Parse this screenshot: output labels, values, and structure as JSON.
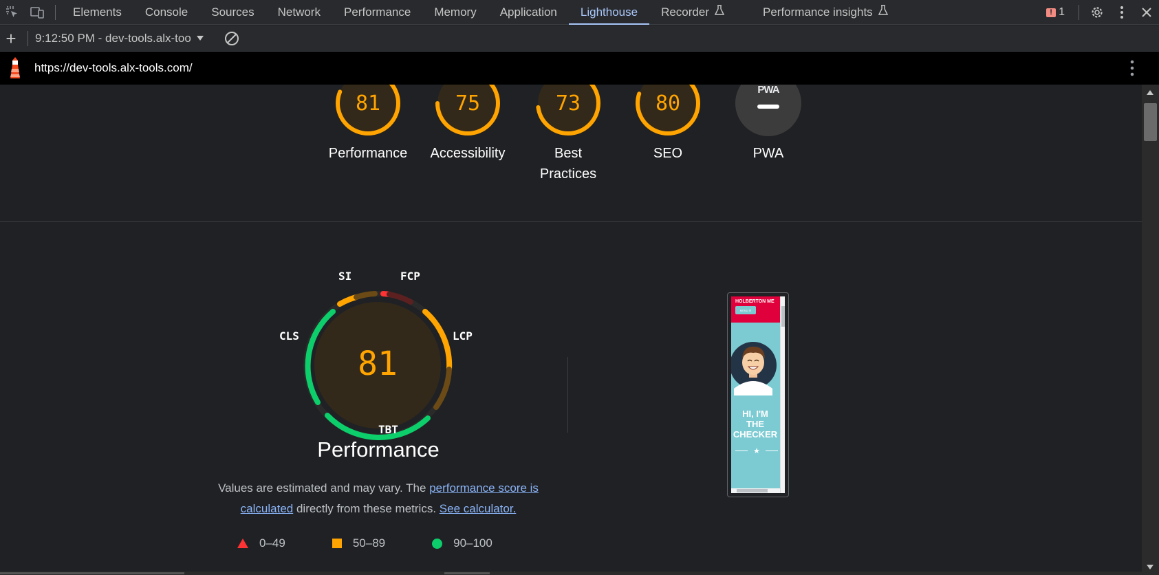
{
  "devtools_tabs": [
    {
      "label": "Elements"
    },
    {
      "label": "Console"
    },
    {
      "label": "Sources"
    },
    {
      "label": "Network"
    },
    {
      "label": "Performance"
    },
    {
      "label": "Memory"
    },
    {
      "label": "Application"
    },
    {
      "label": "Lighthouse",
      "active": true
    },
    {
      "label": "Recorder",
      "icon": "flask-icon"
    },
    {
      "label": "Performance insights",
      "icon": "flask-icon"
    }
  ],
  "issues": {
    "count": "1",
    "icon": "issue-icon"
  },
  "toolbar": {
    "report_label": "9:12:50 PM - dev-tools.alx-too",
    "add_icon": "plus-icon",
    "clear_icon": "clear-icon"
  },
  "url": "https://dev-tools.alx-tools.com/",
  "categories": [
    {
      "label": "Performance",
      "score": "81"
    },
    {
      "label": "Accessibility",
      "score": "75"
    },
    {
      "label": "Best Practices",
      "score": "73"
    },
    {
      "label": "SEO",
      "score": "80"
    },
    {
      "label": "PWA",
      "score": ""
    }
  ],
  "pwa_badge": "PWA",
  "performance": {
    "score": "81",
    "title": "Performance",
    "metrics": {
      "si": "SI",
      "fcp": "FCP",
      "lcp": "LCP",
      "cls": "CLS",
      "tbt": "TBT"
    },
    "desc_prefix": "Values are estimated and may vary. The ",
    "desc_link1": "performance score is calculated",
    "desc_middle": " directly from these metrics. ",
    "desc_link2": "See calculator."
  },
  "legend": [
    {
      "range": "0–49",
      "shape": "triangle",
      "color": "#ff3333"
    },
    {
      "range": "50–89",
      "shape": "square",
      "color": "#ffa400"
    },
    {
      "range": "90–100",
      "shape": "circle",
      "color": "#0cce6b"
    }
  ],
  "screenshot": {
    "brand": "HOLBERTON ME",
    "menu": "MENU ☰",
    "headline_1": "HI, I'M",
    "headline_2": "THE",
    "headline_3": "CHECKER"
  },
  "colors": {
    "average": "#ffa400",
    "pass": "#0cce6b",
    "fail": "#ff3333",
    "accent": "#a8c7fa"
  }
}
